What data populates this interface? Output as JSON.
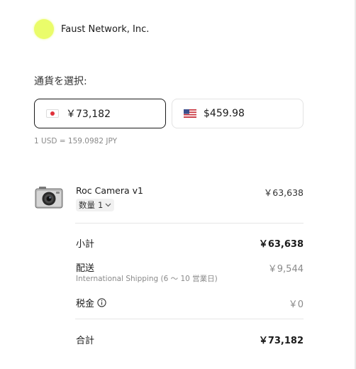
{
  "merchant": {
    "name": "Faust Network, Inc.",
    "logo_color": "#eafc6a"
  },
  "currency": {
    "label": "通貨を選択:",
    "options": [
      {
        "code": "JPY",
        "amount": "￥73,182",
        "flag_icon": "japan-flag-icon",
        "selected": true
      },
      {
        "code": "USD",
        "amount": "$459.98",
        "flag_icon": "us-flag-icon",
        "selected": false
      }
    ],
    "rate": "1 USD = 159.0982 JPY"
  },
  "item": {
    "name": "Roc Camera v1",
    "quantity_label": "数量",
    "quantity_value": "1",
    "price": "￥63,638",
    "icon": "camera-icon"
  },
  "summary": {
    "subtotal_label": "小計",
    "subtotal_value": "￥63,638",
    "shipping_label": "配送",
    "shipping_detail": "International Shipping (6 〜 10 営業日)",
    "shipping_value": "￥9,544",
    "tax_label": "税金",
    "tax_value": "￥0",
    "total_label": "合計",
    "total_value": "￥73,182"
  },
  "colors": {
    "accent": "#1a1a1a",
    "muted": "#8a8a8a",
    "divider": "#e6e6e6"
  }
}
